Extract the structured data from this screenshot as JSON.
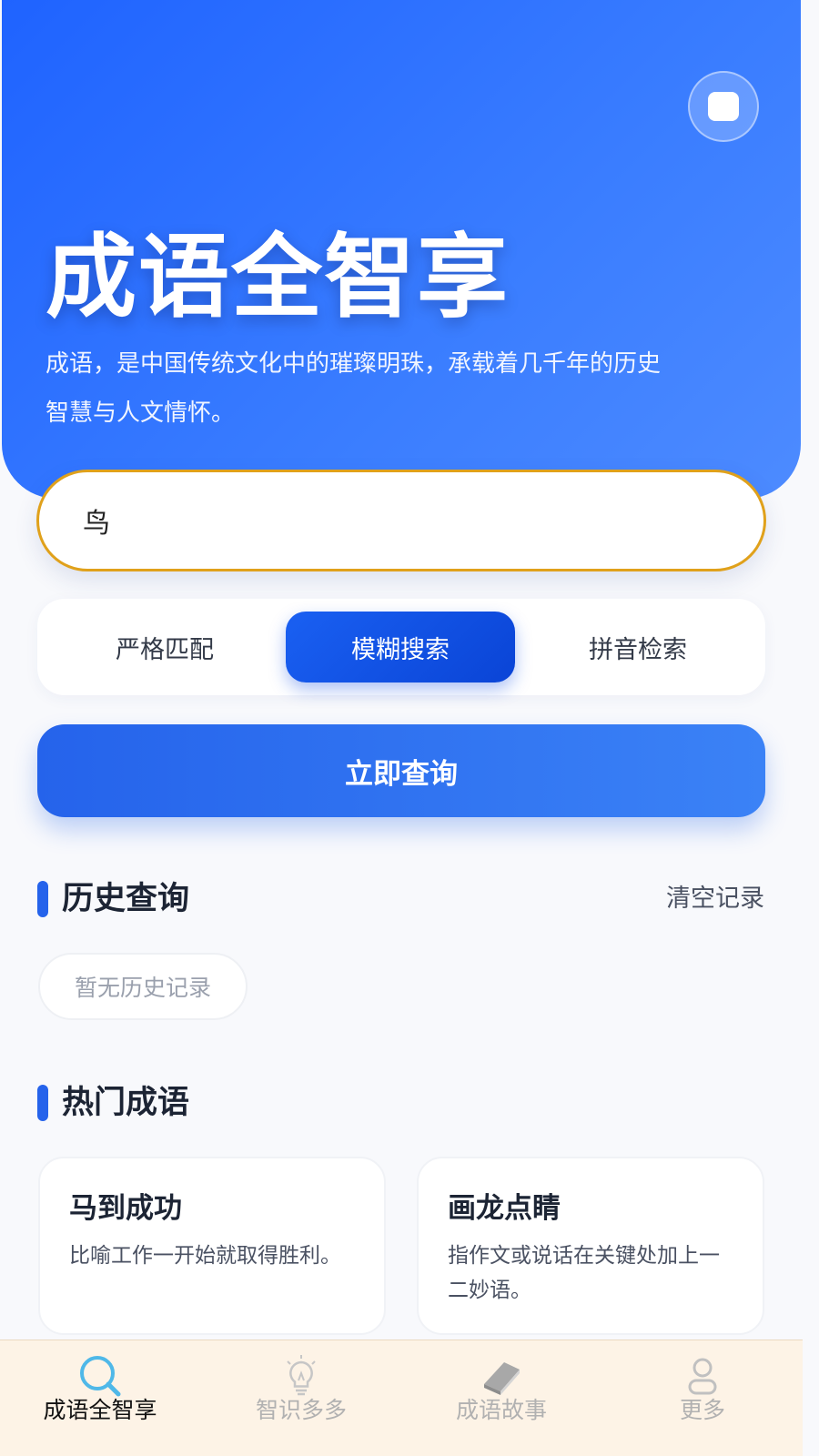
{
  "hero": {
    "title": "成语全智享",
    "description": "成语，是中国传统文化中的璀璨明珠，承载着几千年的历史智慧与人文情怀。",
    "action_icon": "square-icon"
  },
  "search": {
    "value": "鸟"
  },
  "modes": {
    "items": [
      "严格匹配",
      "模糊搜索",
      "拼音检索"
    ],
    "selected": "模糊搜索"
  },
  "query_button": {
    "label": "立即查询"
  },
  "history": {
    "title": "历史查询",
    "clear_label": "清空记录",
    "empty_text": "暂无历史记录"
  },
  "popular": {
    "title": "热门成语",
    "cards": [
      {
        "title": "马到成功",
        "desc": "比喻工作一开始就取得胜利。"
      },
      {
        "title": "画龙点睛",
        "desc": "指作文或说话在关键处加上一二妙语。"
      }
    ]
  },
  "bottom_nav": {
    "items": [
      {
        "label": "成语全智享",
        "icon": "search-icon",
        "active": true
      },
      {
        "label": "智识多多",
        "icon": "lightbulb-icon",
        "active": false
      },
      {
        "label": "成语故事",
        "icon": "book-icon",
        "active": false
      },
      {
        "label": "更多",
        "icon": "user-icon",
        "active": false
      }
    ]
  },
  "colors": {
    "primary": "#2563eb",
    "hero_gradient_start": "#1f63ff",
    "hero_gradient_end": "#4d8bff",
    "search_border": "#e0a11b",
    "nav_background": "#fdf3e6",
    "nav_active_icon": "#4fb8e8"
  }
}
